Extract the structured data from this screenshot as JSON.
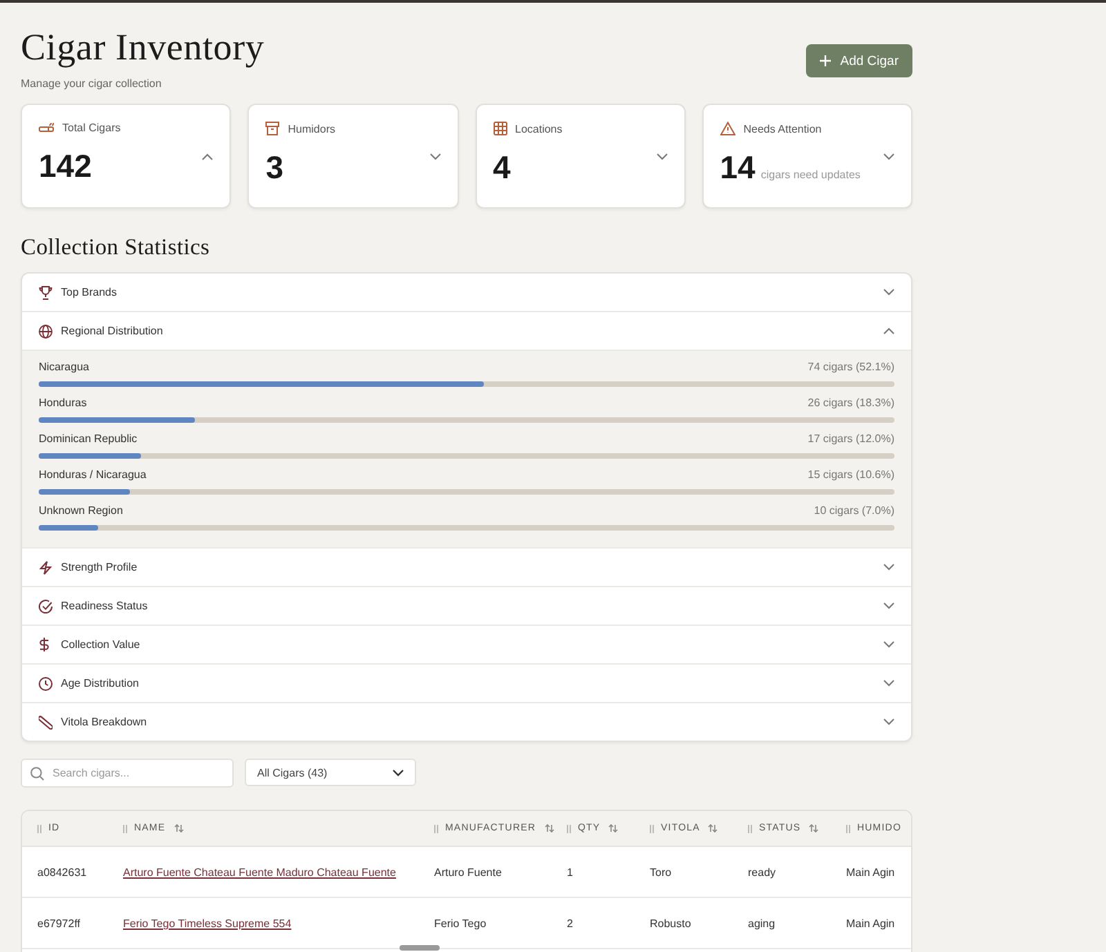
{
  "header": {
    "title": "Cigar Inventory",
    "subtitle": "Manage your cigar collection",
    "add_button": {
      "label": "Add Cigar"
    }
  },
  "stats": [
    {
      "label": "Total Cigars",
      "value": "142",
      "expanded": true
    },
    {
      "label": "Humidors",
      "value": "3",
      "expanded": false
    },
    {
      "label": "Locations",
      "value": "4",
      "expanded": false
    },
    {
      "label": "Needs Attention",
      "value": "14",
      "caption": "cigars need updates",
      "expanded": false
    }
  ],
  "statistics": {
    "title": "Collection Statistics",
    "sections": [
      {
        "label": "Top Brands",
        "expanded": false
      },
      {
        "label": "Regional Distribution",
        "expanded": true,
        "rows": [
          {
            "name": "Nicaragua",
            "reading": "74 cigars (52.1%)",
            "level": 0.521
          },
          {
            "name": "Honduras",
            "reading": "26 cigars (18.3%)",
            "level": 0.183
          },
          {
            "name": "Dominican Republic",
            "reading": "17 cigars (12.0%)",
            "level": 0.12
          },
          {
            "name": "Honduras / Nicaragua",
            "reading": "15 cigars (10.6%)",
            "level": 0.106
          },
          {
            "name": "Unknown Region",
            "reading": "10 cigars (7.0%)",
            "level": 0.07
          }
        ]
      },
      {
        "label": "Strength Profile",
        "expanded": false
      },
      {
        "label": "Readiness Status",
        "expanded": false
      },
      {
        "label": "Collection Value",
        "expanded": false
      },
      {
        "label": "Age Distribution",
        "expanded": false
      },
      {
        "label": "Vitola Breakdown",
        "expanded": false
      }
    ]
  },
  "search": {
    "placeholder": "Search cigars..."
  },
  "filter": {
    "value": "All Cigars (43)"
  },
  "table": {
    "columns": [
      {
        "label": "ID",
        "sortable": false
      },
      {
        "label": "NAME",
        "sortable": true
      },
      {
        "label": "MANUFACTURER",
        "sortable": true
      },
      {
        "label": "QTY",
        "sortable": true
      },
      {
        "label": "VITOLA",
        "sortable": true
      },
      {
        "label": "STATUS",
        "sortable": true
      },
      {
        "label": "HUMIDO",
        "sortable": false
      }
    ],
    "rows": [
      [
        "a0842631",
        "Arturo Fuente Chateau Fuente Maduro Chateau Fuente",
        "Arturo Fuente",
        "1",
        "Toro",
        "ready",
        "Main Agin"
      ],
      [
        "e67972ff",
        "Ferio Tego Timeless Supreme 554",
        "Ferio Tego",
        "2",
        "Robusto",
        "aging",
        "Main Agin"
      ]
    ]
  }
}
